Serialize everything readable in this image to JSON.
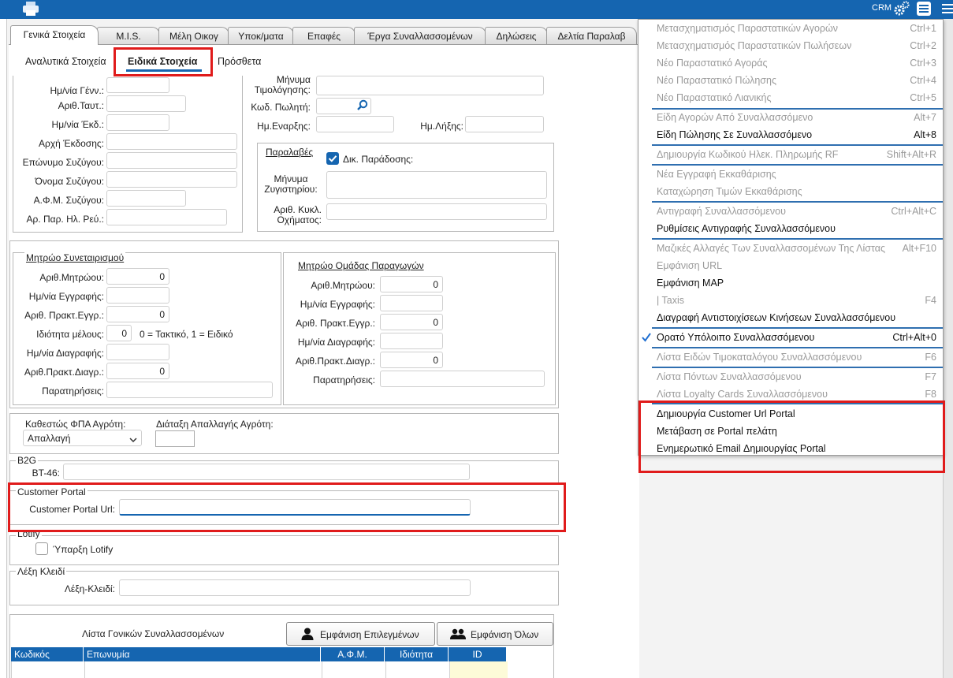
{
  "topbar": {
    "crm_label": "CRM",
    "color": "#1565b0"
  },
  "tabs": [
    "Γενικά Στοιχεία",
    "M.I.S.",
    "Μέλη Οικογ",
    "Υποκ/ματα",
    "Επαφές",
    "Έργα Συναλλασσομένων",
    "Δηλώσεις",
    "Δελτία Παραλαβ"
  ],
  "subtabs": [
    "Αναλυτικά Στοιχεία",
    "Ειδικά Στοιχεία",
    "Πρόσθετα"
  ],
  "personal": {
    "birth_date": "Ημ/νία Γένν.:",
    "id_no": "Αριθ.Ταυτ.:",
    "issue_date": "Ημ/νία Έκδ.:",
    "issuing_authority": "Αρχή Έκδοσης:",
    "spouse_surname": "Επώνυμο Συζύγου:",
    "spouse_name": "Όνομα Συζύγου:",
    "spouse_vat": "Α.Φ.Μ. Συζύγου:",
    "power_meter": "Αρ. Παρ. Ηλ. Ρεύ.:"
  },
  "billing": {
    "message": "Μήνυμα Τιμολόγησης:",
    "salesman": "Κωδ. Πωλητή:",
    "start_date": "Ημ.Εναρξης:",
    "end_date": "Ημ.Λήξης:"
  },
  "receipts": {
    "legend": "Παραλαβές",
    "delivery_right": "Δικ. Παράδοσης:",
    "scale_message": "Μήνυμα Ζυγιστηρίου:",
    "vehicle_plate": "Αριθ. Κυκλ. Οχήματος:"
  },
  "coop": {
    "legend": "Μητρώο Συνεταιρισμού",
    "reg_no": "Αριθ.Μητρώου:",
    "reg_no_val": "0",
    "reg_date": "Ημ/νία Εγγραφής:",
    "act_no": "Αριθ. Πρακτ.Εγγρ.:",
    "act_no_val": "0",
    "member_type": "Ιδιότητα μέλους:",
    "member_type_val": "0",
    "member_hint": "0 = Τακτικό, 1 = Ειδικό",
    "del_date": "Ημ/νία Διαγραφής:",
    "del_act": "Αριθ.Πρακτ.Διαγρ.:",
    "del_act_val": "0",
    "notes": "Παρατηρήσεις:"
  },
  "producers": {
    "legend": "Μητρώο Ομάδας Παραγωγών",
    "reg_no": "Αριθ.Μητρώου:",
    "reg_no_val": "0",
    "reg_date": "Ημ/νία Εγγραφής:",
    "act_no": "Αριθ. Πρακτ.Εγγρ.:",
    "act_no_val": "0",
    "del_date": "Ημ/νία Διαγραφής:",
    "del_act": "Αριθ.Πρακτ.Διαγρ.:",
    "del_act_val": "0",
    "notes": "Παρατηρήσεις:"
  },
  "vat": {
    "status_label": "Καθεστώς ΦΠΑ Αγρότη:",
    "status_value": "Απαλλαγή",
    "exemption_label": "Διάταξη Απαλλαγής Αγρότη:"
  },
  "b2g": {
    "legend": "B2G",
    "bt46": "BT-46:"
  },
  "portal": {
    "legend": "Customer Portal",
    "url_label": "Customer Portal Url:"
  },
  "lotify": {
    "legend": "Lotify",
    "exists": "Ύπαρξη Lotify"
  },
  "keyword": {
    "legend": "Λέξη Κλειδί",
    "label": "Λέξη-Κλειδί:"
  },
  "parents": {
    "title": "Λίστα Γονικών Συναλλασσομένων",
    "show_selected": "Εμφάνιση Επιλεγμένων",
    "show_all": "Εμφάνιση Όλων",
    "columns": [
      "Κωδικός",
      "Επωνυμία",
      "Α.Φ.Μ.",
      "Ιδιότητα",
      "ID"
    ]
  },
  "menu": [
    {
      "label": "Μετασχηματισμός Παραστατικών Αγορών",
      "shortcut": "Ctrl+1"
    },
    {
      "label": "Μετασχηματισμός Παραστατικών Πωλήσεων",
      "shortcut": "Ctrl+2"
    },
    {
      "label": "Νέο Παραστατικό Αγοράς",
      "shortcut": "Ctrl+3"
    },
    {
      "label": "Νέο Παραστατικό Πώλησης",
      "shortcut": "Ctrl+4"
    },
    {
      "label": "Νέο Παραστατικό Λιανικής",
      "shortcut": "Ctrl+5"
    },
    {
      "label": "Είδη Αγορών Από Συναλλασσόμενο",
      "shortcut": "Alt+7"
    },
    {
      "label": "Είδη Πώλησης Σε Συναλλασσόμενο",
      "shortcut": "Alt+8"
    },
    {
      "label": "Δημιουργία Κωδικού Ηλεκ. Πληρωμής RF",
      "shortcut": "Shift+Alt+R"
    },
    {
      "label": "Νέα Εγγραφή Εκκαθάρισης",
      "shortcut": ""
    },
    {
      "label": "Καταχώρηση Τιμών Εκκαθάρισης",
      "shortcut": ""
    },
    {
      "label": "Αντιγραφή Συναλλασσόμενου",
      "shortcut": "Ctrl+Alt+C"
    },
    {
      "label": "Ρυθμίσεις Αντιγραφής Συναλλασσόμενου",
      "shortcut": ""
    },
    {
      "label": "Μαζικές Αλλαγές Των Συναλλασσομένων Της Λίστας",
      "shortcut": "Alt+F10"
    },
    {
      "label": "Εμφάνιση URL",
      "shortcut": ""
    },
    {
      "label": "Εμφάνιση MAP",
      "shortcut": ""
    },
    {
      "label": "| Taxis",
      "shortcut": "F4"
    },
    {
      "label": "Διαγραφή Αντιστοιχίσεων Κινήσεων Συναλλασσόμενου",
      "shortcut": ""
    },
    {
      "label": "Ορατό Υπόλοιπο Συναλλασσόμενου",
      "shortcut": "Ctrl+Alt+0"
    },
    {
      "label": "Λίστα Ειδών Τιμοκαταλόγου Συναλλασσόμενου",
      "shortcut": "F6"
    },
    {
      "label": "Λίστα Πόντων Συναλλασσόμενου",
      "shortcut": "F7"
    },
    {
      "label": "Λίστα Loyalty Cards Συναλλασσόμενου",
      "shortcut": "F8"
    },
    {
      "label": "Δημιουργία Customer Url Portal",
      "shortcut": ""
    },
    {
      "label": "Μετάβαση σε Portal πελάτη",
      "shortcut": ""
    },
    {
      "label": "Ενημερωτικό Email Δημιουργίας Portal",
      "shortcut": ""
    }
  ]
}
